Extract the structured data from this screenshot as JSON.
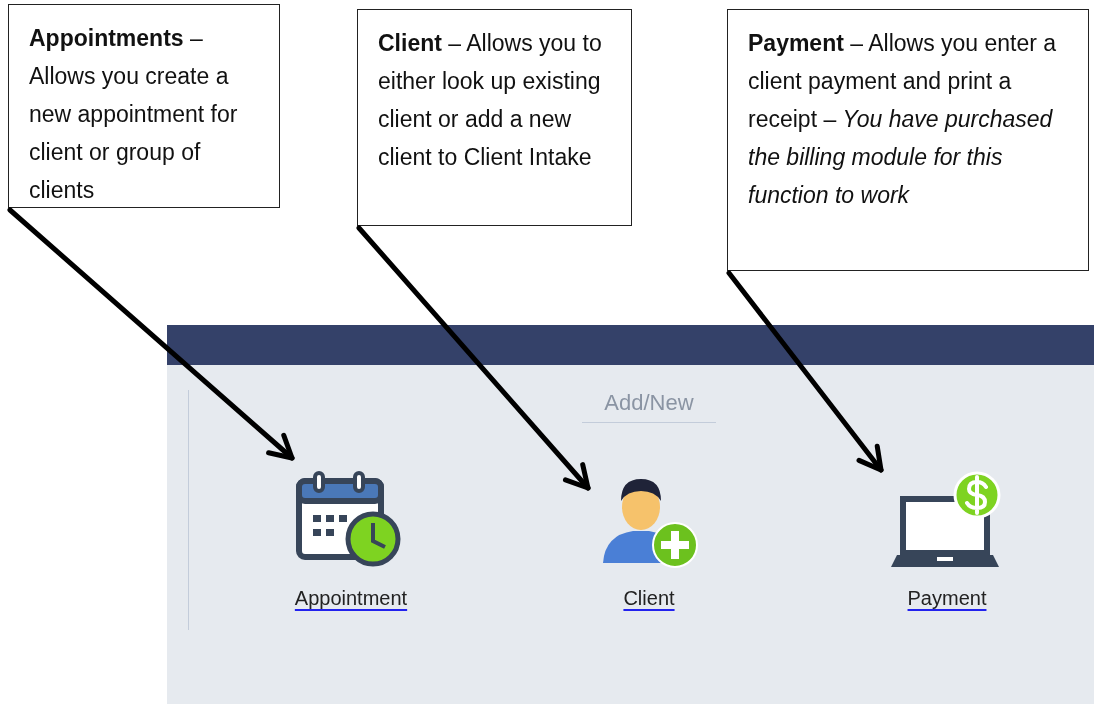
{
  "callouts": [
    {
      "text": "**Appointments** – Allows you create a new appointment for client or group of clients"
    },
    {
      "text": "**Client** – Allows you to either look up existing client or add a new client to Client Intake"
    },
    {
      "text": "**Payment** – Allows you enter a client payment and print a receipt – *You have purchased the billing module for this function to work*"
    }
  ],
  "screen": {
    "section_title": "Add/New",
    "items": [
      {
        "label": "Appointment",
        "kind": "calendar"
      },
      {
        "label": "Client",
        "kind": "person"
      },
      {
        "label": "Payment",
        "kind": "laptop"
      }
    ]
  }
}
